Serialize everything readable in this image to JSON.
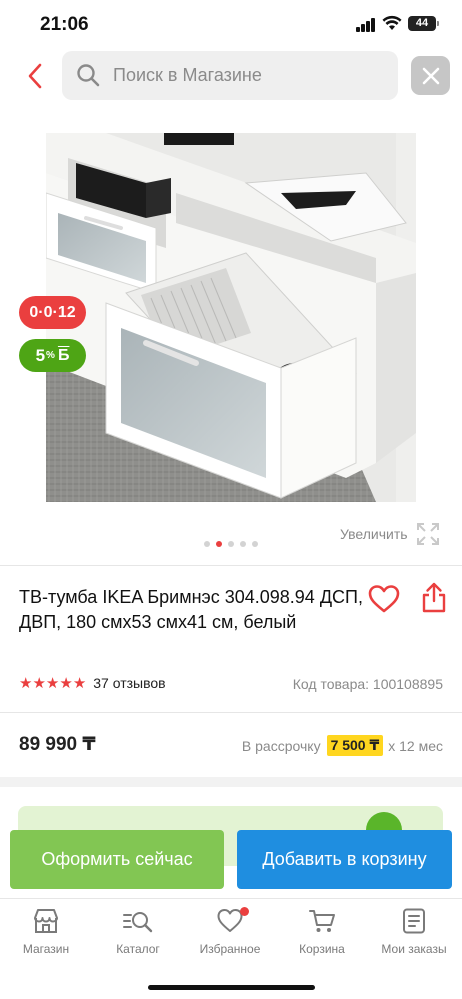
{
  "status_bar": {
    "time": "21:06",
    "battery": "44"
  },
  "search": {
    "placeholder": "Поиск в Магазине"
  },
  "badges": {
    "installment": "0·0·12",
    "bonus_percent": "5",
    "bonus_sign": "%",
    "bonus_letter": "Б"
  },
  "gallery": {
    "zoom_label": "Увеличить",
    "dot_count": 5,
    "active_dot": 1
  },
  "product": {
    "title": "ТВ-тумба IKEA Бримнэс 304.098.94 ДСП, ДВП, 180 смx53 смx41 см, белый",
    "rating_stars": 5,
    "reviews": "37 отзывов",
    "code": "Код товара: 100108895",
    "price": "89 990 ₸",
    "installment_prefix": "В рассрочку",
    "installment_monthly": "7 500 ₸",
    "installment_suffix": "x 12 мес"
  },
  "actions": {
    "checkout": "Оформить сейчас",
    "add_to_cart": "Добавить в корзину"
  },
  "tabs": [
    {
      "label": "Магазин",
      "icon": "store-icon"
    },
    {
      "label": "Каталог",
      "icon": "catalog-search-icon"
    },
    {
      "label": "Избранное",
      "icon": "heart-icon"
    },
    {
      "label": "Корзина",
      "icon": "cart-icon"
    },
    {
      "label": "Мои заказы",
      "icon": "orders-icon"
    }
  ],
  "colors": {
    "accent_red": "#ea3f3f",
    "green": "#82c653",
    "blue": "#1f8ee0",
    "highlight_yellow": "#ffd61f"
  }
}
